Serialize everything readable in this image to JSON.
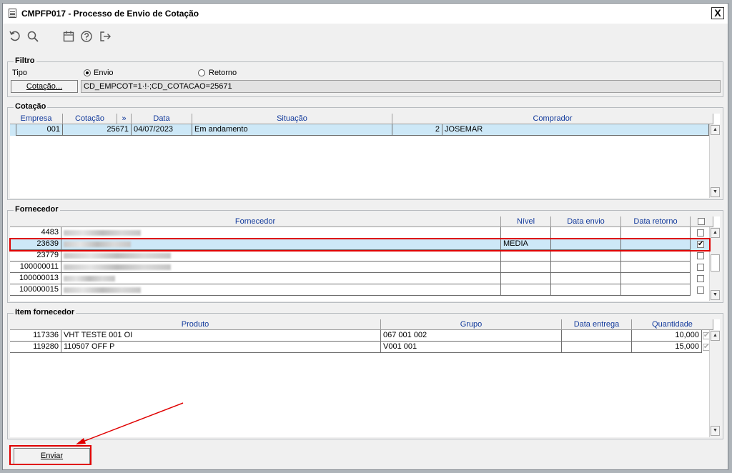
{
  "window": {
    "title": "CMPFP017 - Processo de Envio de Cotação",
    "close_label": "X"
  },
  "toolbar": {
    "icons": [
      "undo-icon",
      "search-icon",
      "calendar-icon",
      "help-icon",
      "exit-icon"
    ]
  },
  "filtro": {
    "label": "Filtro",
    "tipo_label": "Tipo",
    "radio_envio": "Envio",
    "radio_retorno": "Retorno",
    "selected": "Envio",
    "cotacao_button": "Cotação...",
    "cotacao_value": "CD_EMPCOT=1·!·;CD_COTACAO=25671"
  },
  "cotacao": {
    "label": "Cotação",
    "columns": [
      "Empresa",
      "Cotação",
      "»",
      "Data",
      "Situação",
      "Comprador"
    ],
    "rows": [
      {
        "empresa": "001",
        "cotacao": "25671",
        "data": "04/07/2023",
        "situacao": "Em andamento",
        "comprador_cod": "2",
        "comprador_nome": "JOSEMAR"
      }
    ]
  },
  "fornecedor": {
    "label": "Fornecedor",
    "columns": [
      "Fornecedor",
      "Nível",
      "Data envio",
      "Data retorno"
    ],
    "rows": [
      {
        "codigo": "4483",
        "nivel": "",
        "data_envio": "",
        "data_retorno": "",
        "checked": false
      },
      {
        "codigo": "23639",
        "nivel": "MEDIA",
        "data_envio": "",
        "data_retorno": "",
        "checked": true
      },
      {
        "codigo": "23779",
        "nivel": "",
        "data_envio": "",
        "data_retorno": "",
        "checked": false
      },
      {
        "codigo": "100000011",
        "nivel": "",
        "data_envio": "",
        "data_retorno": "",
        "checked": false
      },
      {
        "codigo": "100000013",
        "nivel": "",
        "data_envio": "",
        "data_retorno": "",
        "checked": false
      },
      {
        "codigo": "100000015",
        "nivel": "",
        "data_envio": "",
        "data_retorno": "",
        "checked": false
      }
    ]
  },
  "item_fornecedor": {
    "label": "Item fornecedor",
    "columns": [
      "Produto",
      "Grupo",
      "Data entrega",
      "Quantidade"
    ],
    "rows": [
      {
        "codigo": "117336",
        "produto": "VHT TESTE 001 OI",
        "grupo": "067 001 002",
        "data_entrega": "",
        "quantidade": "10,000",
        "checked": true
      },
      {
        "codigo": "119280",
        "produto": "110507 OFF P",
        "grupo": "V001 001",
        "data_entrega": "",
        "quantidade": "15,000",
        "checked": true
      }
    ]
  },
  "actions": {
    "enviar": "Enviar"
  },
  "colors": {
    "highlight": "#e00000",
    "selected_row": "#cde8f7",
    "header_text": "#123a9c"
  }
}
